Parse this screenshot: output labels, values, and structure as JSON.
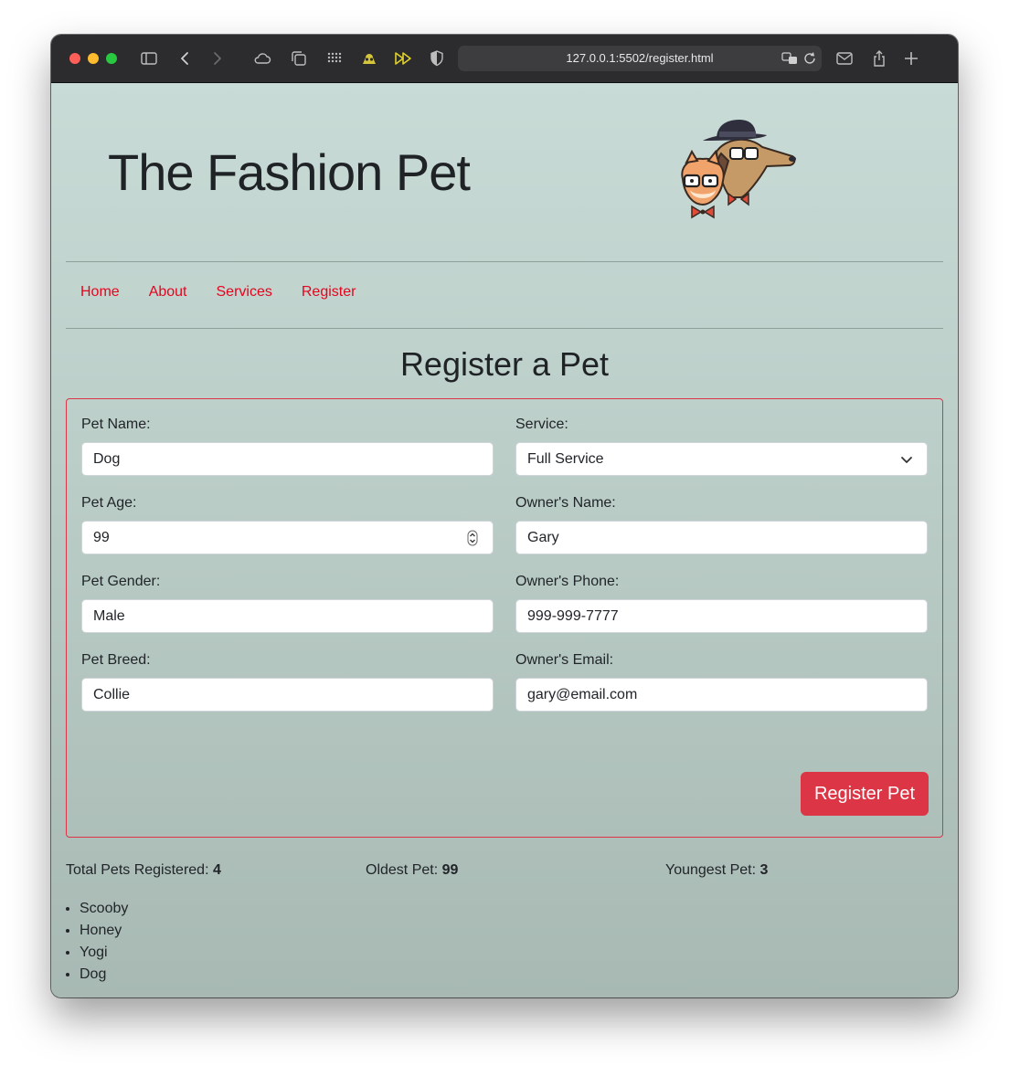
{
  "browser": {
    "url": "127.0.0.1:5502/register.html"
  },
  "site": {
    "title": "The Fashion Pet",
    "nav": [
      "Home",
      "About",
      "Services",
      "Register"
    ]
  },
  "form": {
    "heading": "Register a Pet",
    "fields": {
      "pet_name": {
        "label": "Pet Name:",
        "value": "Dog"
      },
      "pet_age": {
        "label": "Pet Age:",
        "value": "99"
      },
      "pet_gender": {
        "label": "Pet Gender:",
        "value": "Male"
      },
      "pet_breed": {
        "label": "Pet Breed:",
        "value": "Collie"
      },
      "service": {
        "label": "Service:",
        "value": "Full Service"
      },
      "owner_name": {
        "label": "Owner's Name:",
        "value": "Gary"
      },
      "owner_phone": {
        "label": "Owner's Phone:",
        "value": "999-999-7777"
      },
      "owner_email": {
        "label": "Owner's Email:",
        "value": "gary@email.com"
      }
    },
    "submit_label": "Register Pet"
  },
  "stats": {
    "total_label": "Total Pets Registered:",
    "total_value": "4",
    "oldest_label": "Oldest Pet:",
    "oldest_value": "99",
    "youngest_label": "Youngest Pet:",
    "youngest_value": "3"
  },
  "pets": [
    "Scooby",
    "Honey",
    "Yogi",
    "Dog"
  ],
  "colors": {
    "accent": "#dc3545",
    "nav_link": "#e3061f",
    "toolbar": "#2c2c2e"
  },
  "icons": [
    "sidebar-icon",
    "back-icon",
    "forward-icon",
    "cloud-icon",
    "tabs-icon",
    "grid-icon",
    "extension-icon",
    "fast-forward-icon",
    "shield-icon",
    "translate-icon",
    "reload-icon",
    "mail-icon",
    "share-icon",
    "new-tab-icon",
    "chevron-down-icon",
    "stepper-icon"
  ]
}
